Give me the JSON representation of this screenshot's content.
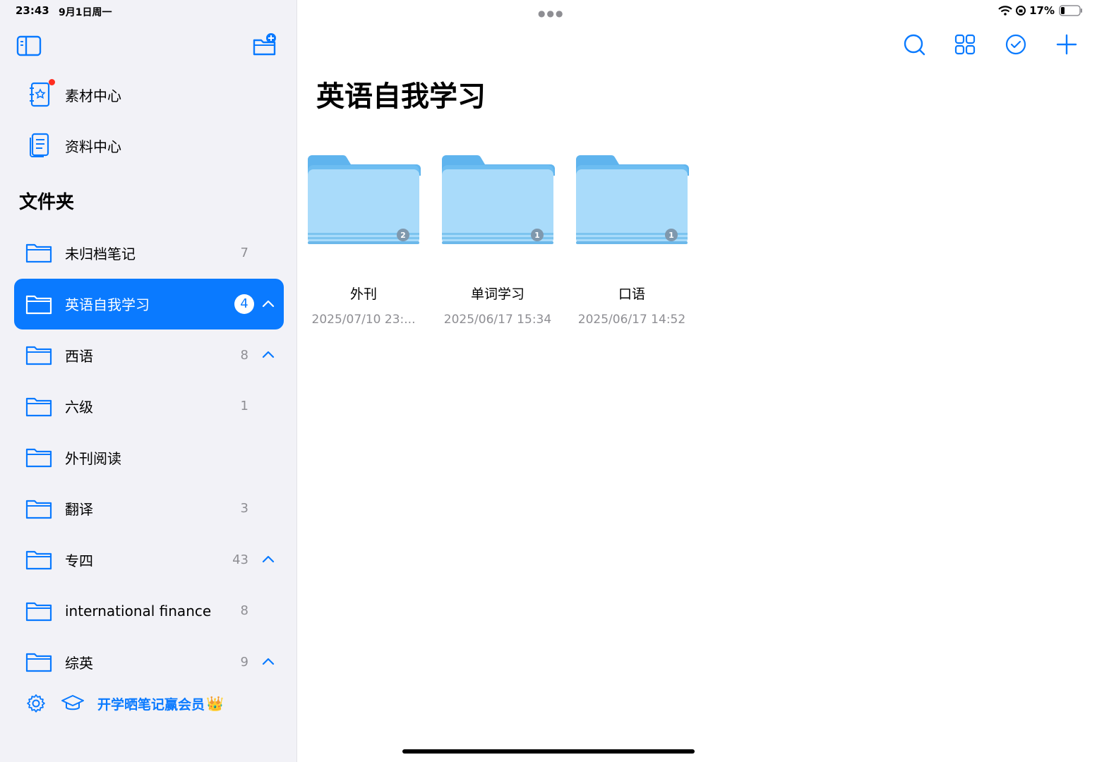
{
  "status": {
    "time": "23:43",
    "date": "9月1日周一",
    "battery": "17%"
  },
  "sidebar": {
    "top_items": [
      {
        "label": "素材中心",
        "icon": "material-book-icon",
        "has_dot": true
      },
      {
        "label": "资料中心",
        "icon": "document-icon",
        "has_dot": false
      }
    ],
    "section_title": "文件夹",
    "folders": [
      {
        "name": "未归档笔记",
        "count": "7",
        "expandable": false,
        "selected": false
      },
      {
        "name": "英语自我学习",
        "count": "4",
        "expandable": true,
        "selected": true
      },
      {
        "name": "西语",
        "count": "8",
        "expandable": true,
        "selected": false
      },
      {
        "name": "六级",
        "count": "1",
        "expandable": false,
        "selected": false
      },
      {
        "name": "外刊阅读",
        "count": "",
        "expandable": false,
        "selected": false
      },
      {
        "name": "翻译",
        "count": "3",
        "expandable": false,
        "selected": false
      },
      {
        "name": "专四",
        "count": "43",
        "expandable": true,
        "selected": false
      },
      {
        "name": "international finance",
        "count": "8",
        "expandable": false,
        "selected": false
      },
      {
        "name": "综英",
        "count": "9",
        "expandable": true,
        "selected": false
      }
    ],
    "promo": "开学晒笔记赢会员",
    "crown": "👑"
  },
  "main": {
    "title": "英语自我学习",
    "folders": [
      {
        "name": "外刊",
        "date": "2025/07/10 23:...",
        "badge": "2"
      },
      {
        "name": "单词学习",
        "date": "2025/06/17 15:34",
        "badge": "1"
      },
      {
        "name": "口语",
        "date": "2025/06/17 14:52",
        "badge": "1"
      }
    ]
  },
  "colors": {
    "accent": "#0a7aff",
    "sidebar_bg": "#f2f2f7",
    "folder_blue": "#8ccff6"
  }
}
